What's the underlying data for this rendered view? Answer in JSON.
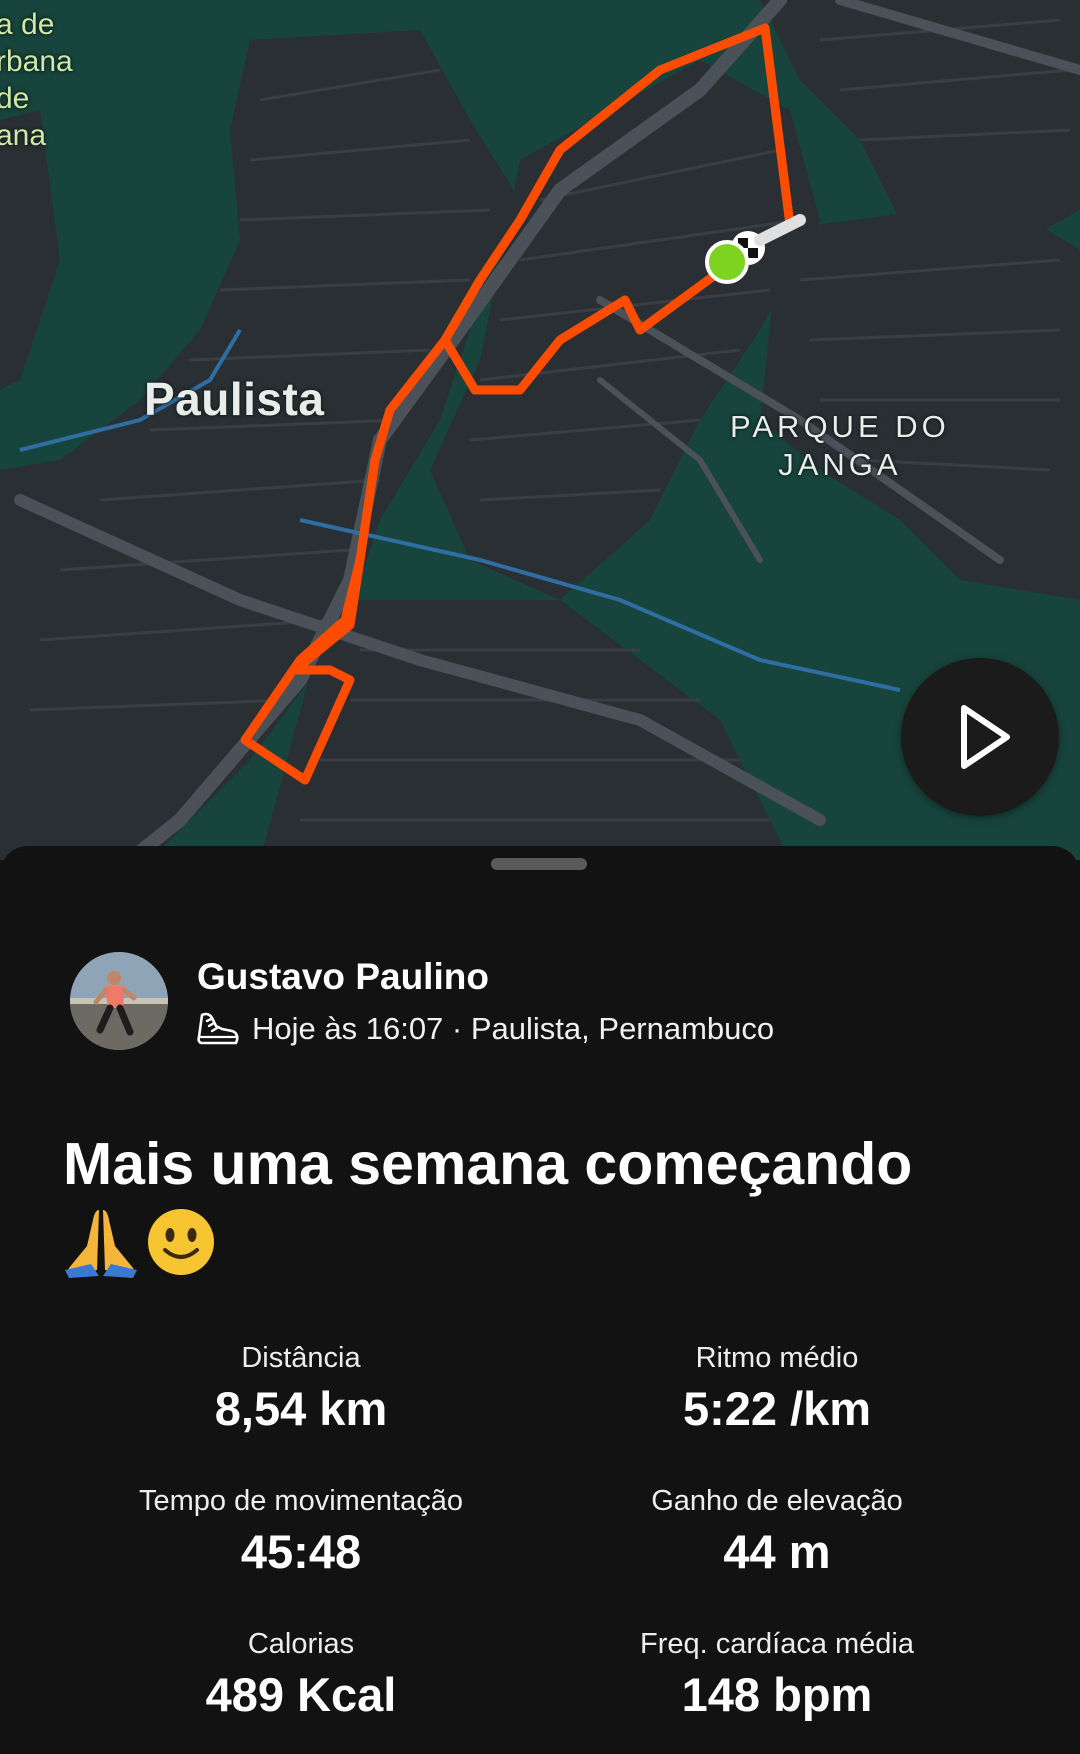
{
  "map": {
    "labels": {
      "city": "Paulista",
      "park_line1": "PARQUE DO",
      "park_line2": "JANGA",
      "corner_line1": "a de",
      "corner_line2": "rbana",
      "corner_line3": "de",
      "corner_line4": "ana"
    },
    "route_color": "#fc4c02",
    "start_color": "#7ed321",
    "play_icon": "play-icon"
  },
  "activity": {
    "athlete_name": "Gustavo Paulino",
    "activity_icon": "running-shoe-icon",
    "time": "Hoje às 16:07",
    "separator": " · ",
    "location": "Paulista, Pernambuco",
    "title": "Mais uma semana começando",
    "emojis": [
      "praying-hands-emoji",
      "smiling-face-emoji"
    ]
  },
  "stats": [
    {
      "label": "Distância",
      "value": "8,54 km"
    },
    {
      "label": "Ritmo médio",
      "value": "5:22 /km"
    },
    {
      "label": "Tempo de movimentação",
      "value": "45:48"
    },
    {
      "label": "Ganho de elevação",
      "value": "44 m"
    },
    {
      "label": "Calorias",
      "value": "489 Kcal"
    },
    {
      "label": "Freq. cardíaca média",
      "value": "148 bpm"
    }
  ]
}
